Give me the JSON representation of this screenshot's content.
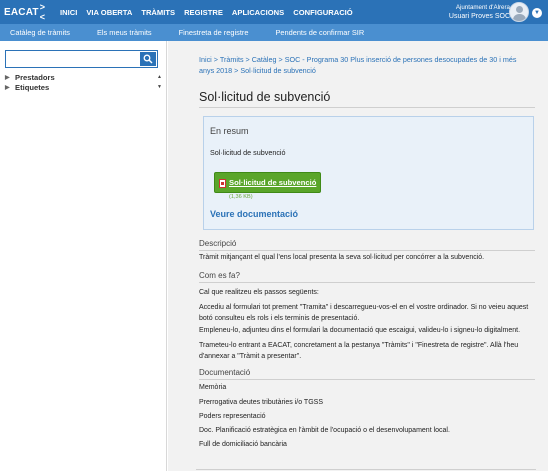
{
  "header": {
    "logo": "EACAT",
    "logo_mark": "><",
    "nav": [
      "INICI",
      "VIA OBERTA",
      "TRÀMITS",
      "REGISTRE",
      "APLICACIONS",
      "CONFIGURACIÓ"
    ],
    "org": "Ajuntament d'Alrera",
    "user": "Usuari Proves SOC",
    "brand_color": "#2b72b7"
  },
  "subnav": [
    "Catàleg de tràmits",
    "Els meus tràmits",
    "Finestreta de registre",
    "Pendents de confirmar SIR"
  ],
  "sidebar": {
    "search": {
      "value": "",
      "placeholder": ""
    },
    "tree": [
      "Prestadors",
      "Etiquetes"
    ]
  },
  "main": {
    "breadcrumb": "Inici > Tràmits > Catàleg > SOC - Programa 30 Plus inserció de persones desocupades de 30 i més anys 2018 > Sol·licitud de subvenció",
    "title": "Sol·licitud de subvenció",
    "resum": {
      "title": "En resum",
      "text": "Sol·licitud de subvenció",
      "button": "Sol·licitud de subvenció",
      "button_sub": "(1,36 KB)",
      "doc_link": "Veure documentació",
      "button_color": "#5aa52a"
    },
    "descripcio": {
      "heading": "Descripció",
      "text": "Tràmit mitjançant el qual l'ens local presenta la seva sol·licitud per concórrer a la subvenció."
    },
    "com_es_fa": {
      "heading": "Com es fa?",
      "p1": "Cal que realitzeu els passos següents:",
      "p2": "Accediu al formulari tot prement \"Tramita\" i descarregueu-vos-el en el vostre ordinador. Si no veieu aquest botó consulteu els rols i els terminis de presentació.",
      "p3": "Empleneu-lo, adjunteu dins el formulari la documentació que escaigui, valideu-lo i signeu-lo digitalment.",
      "p4": "Trameteu-lo entrant a EACAT, concretament a la pestanya \"Tràmits\" i \"Finestreta de registre\". Allà l'heu d'annexar a \"Tràmit a presentar\"."
    },
    "documentacio": {
      "heading": "Documentació",
      "items": [
        "Memòria",
        "Prerrogativa deutes tributàries i/o TGSS",
        "Poders representació",
        "Doc. Planificació estratègica en l'àmbit de l'ocupació o el desenvolupament local.",
        "Full de domiciliació bancària"
      ]
    }
  }
}
